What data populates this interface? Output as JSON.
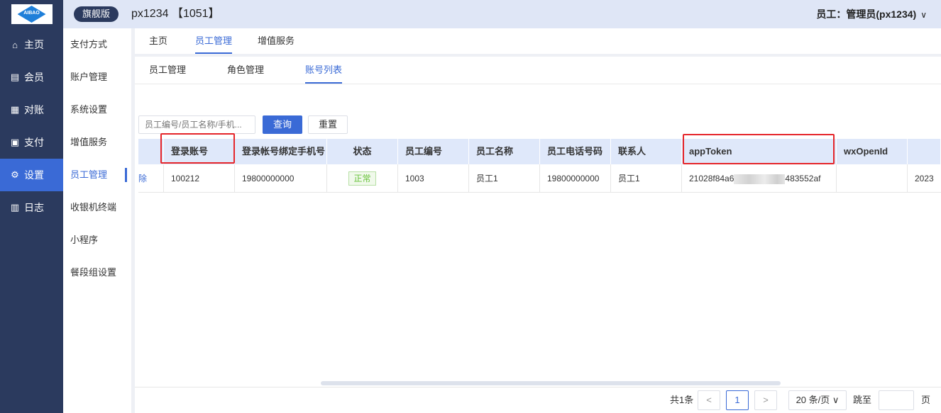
{
  "header": {
    "logo_text": "AIBAO",
    "edition": "旗舰版",
    "store": "px1234 【1051】",
    "user": "员工：管理员(px1234)",
    "user_chevron": "∨"
  },
  "sidebar": {
    "items": [
      {
        "label": "主页",
        "icon": "home-icon",
        "glyph": "⌂",
        "active": false
      },
      {
        "label": "会员",
        "icon": "member-icon",
        "glyph": "▤",
        "active": false
      },
      {
        "label": "对账",
        "icon": "reconcile-icon",
        "glyph": "▦",
        "active": false
      },
      {
        "label": "支付",
        "icon": "payment-icon",
        "glyph": "▣",
        "active": false
      },
      {
        "label": "设置",
        "icon": "gear-icon",
        "glyph": "⚙",
        "active": true
      },
      {
        "label": "日志",
        "icon": "log-icon",
        "glyph": "▥",
        "active": false
      }
    ]
  },
  "subnav": {
    "items": [
      {
        "label": "支付方式"
      },
      {
        "label": "账户管理"
      },
      {
        "label": "系统设置"
      },
      {
        "label": "增值服务"
      },
      {
        "label": "员工管理"
      },
      {
        "label": "收银机终端"
      },
      {
        "label": "小程序"
      },
      {
        "label": "餐段组设置"
      }
    ],
    "active_index": 4
  },
  "tabs_top": [
    {
      "label": "主页"
    },
    {
      "label": "员工管理"
    },
    {
      "label": "增值服务"
    }
  ],
  "tabs_inner": [
    {
      "label": "员工管理"
    },
    {
      "label": "角色管理"
    },
    {
      "label": "账号列表"
    }
  ],
  "search": {
    "placeholder": "员工编号/员工名称/手机...",
    "query_label": "查询",
    "reset_label": "重置"
  },
  "table": {
    "columns": [
      "登录账号",
      "登录帐号绑定手机号",
      "状态",
      "员工编号",
      "员工名称",
      "员工电话号码",
      "联系人",
      "appToken",
      "wxOpenId"
    ],
    "row": {
      "action": "除",
      "account": "100212",
      "bound_phone": "19800000000",
      "status": "正常",
      "employee_no": "1003",
      "employee_name": "员工1",
      "employee_phone": "19800000000",
      "contact": "员工1",
      "token_prefix": "21028f84a6",
      "token_suffix": "483552af",
      "wx_open_id": "",
      "date_partial": "2023"
    }
  },
  "pagination": {
    "total": "共1条",
    "prev": "<",
    "page": "1",
    "next": ">",
    "page_size": "20 条/页",
    "page_size_chevron": "∨",
    "goto_label": "跳至",
    "page_unit": "页",
    "goto_value": ""
  },
  "colors": {
    "accent": "#3a6ad6",
    "sidebar_bg": "#2b3a5e",
    "highlight": "#e5252a",
    "status_green": "#67c23a"
  }
}
